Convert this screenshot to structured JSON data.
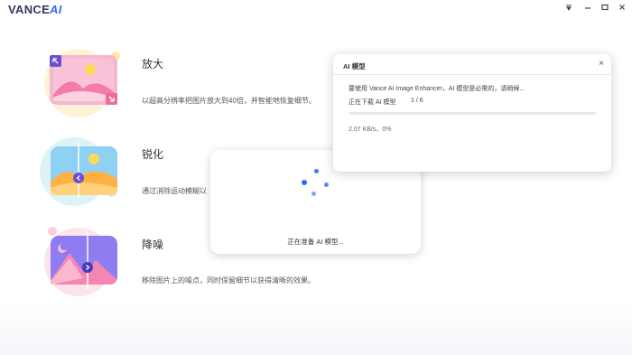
{
  "app": {
    "logo_main": "VANCE",
    "logo_ai": "AI"
  },
  "window_controls": {
    "menu_icon": "menu-down-icon",
    "minimize_icon": "minimize-icon",
    "maximize_icon": "maximize-icon",
    "close_icon": "close-icon"
  },
  "features": [
    {
      "title": "放大",
      "desc": "以超高分辨率把图片放大到40倍，并智能地恢复细节。",
      "icon": "upscale-icon"
    },
    {
      "title": "锐化",
      "desc": "通过消除运动模糊以",
      "icon": "sharpen-icon"
    },
    {
      "title": "降噪",
      "desc": "移除图片上的噪点，同时保留细节以获得清晰的效果。",
      "icon": "denoise-icon"
    }
  ],
  "spinner": {
    "text": "正在准备 AI 模型..."
  },
  "dialog": {
    "title": "AI 模型",
    "close": "×",
    "message": "要使用 Vance AI Image Enhancer，AI 模型是必需的，请稍候...",
    "status_label": "正在下载 AI 模型",
    "count": "1 / 6",
    "speed": "2.07 KB/s，0%",
    "progress_fraction": 0.0
  },
  "colors": {
    "accent": "#2f6df6",
    "pink": "#f47aa9",
    "yellow": "#ffd95a",
    "blue_light": "#8fd0f5"
  }
}
